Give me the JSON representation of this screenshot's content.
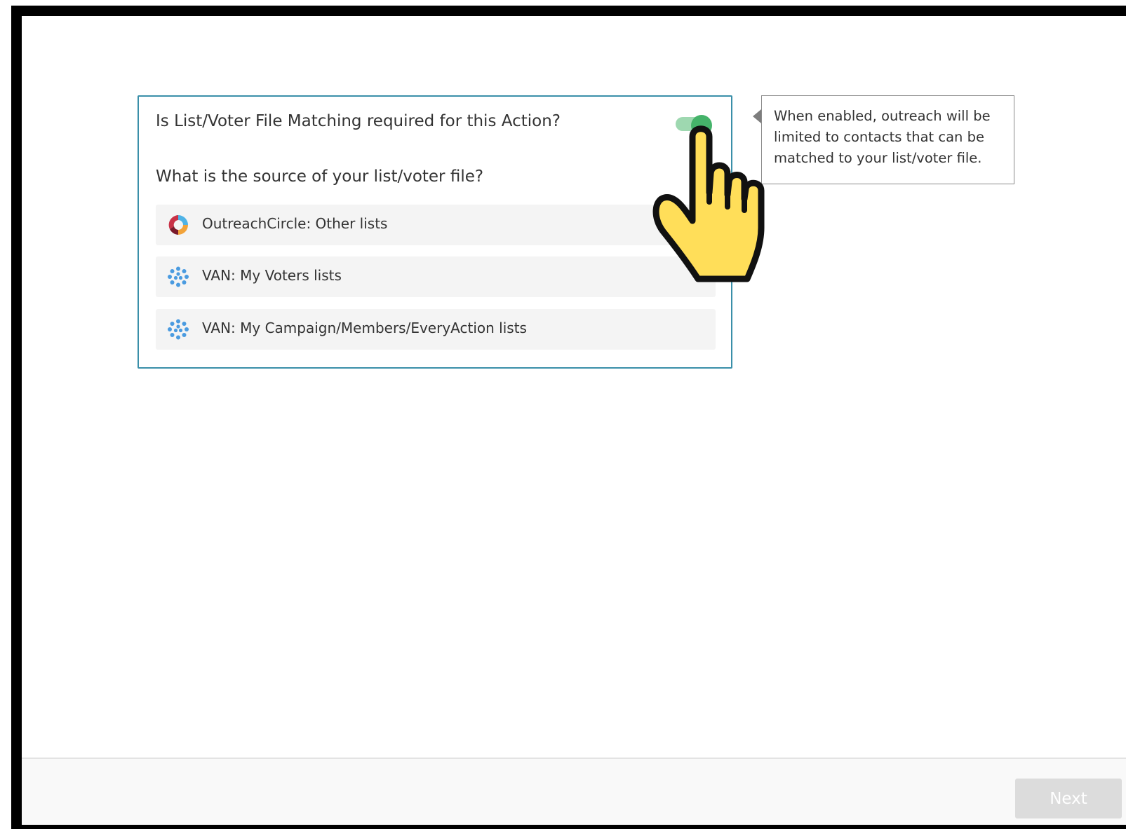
{
  "card": {
    "question": "Is List/Voter File Matching required for this Action?",
    "toggle_enabled": true,
    "source_question": "What is the source of your list/voter file?",
    "options": [
      {
        "icon": "outreachcircle-logo-icon",
        "label": "OutreachCircle: Other lists"
      },
      {
        "icon": "van-logo-icon",
        "label": "VAN: My Voters lists"
      },
      {
        "icon": "van-logo-icon",
        "label": "VAN: My Campaign/Members/EveryAction lists"
      }
    ]
  },
  "tooltip": {
    "text": "When enabled, outreach will be limited to contacts that can be matched to your list/voter file."
  },
  "footer": {
    "next_label": "Next"
  },
  "colors": {
    "card_border": "#3a8fa9",
    "toggle_on": "#45b36a",
    "toggle_track": "#9ed8b0",
    "option_background": "#f4f4f4",
    "next_disabled": "#dcdcdc",
    "pointer_hand": "#ffde59"
  },
  "overlay": {
    "icon": "pointer-hand-icon"
  }
}
